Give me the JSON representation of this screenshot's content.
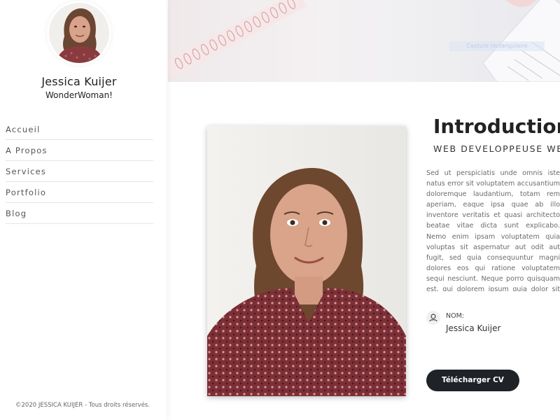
{
  "profile": {
    "name": "Jessica Kuijer",
    "tagline": "WonderWoman!"
  },
  "nav": {
    "items": [
      {
        "label": "Accueil"
      },
      {
        "label": "A Propos"
      },
      {
        "label": "Services"
      },
      {
        "label": "Portfolio"
      },
      {
        "label": "Blog"
      }
    ]
  },
  "footer": {
    "copyright": "©2020 JESSICA KUIJER - Tous droits réservés."
  },
  "hero": {
    "overlay_text": "Capture rectangulaire"
  },
  "intro": {
    "title": "Introduction",
    "subtitle": "WEB DEVELOPPEUSE WEB",
    "description": "Sed ut perspiciatis unde omnis iste natus error sit voluptatem accusantium doloremque laudantium, totam rem aperiam, eaque ipsa quae ab illo inventore veritatis et quasi architecto beatae vitae dicta sunt explicabo. Nemo enim ipsam voluptatem quia voluptas sit aspernatur aut odit aut fugit, sed quia consequuntur magni dolores eos qui ratione voluptatem sequi nesciunt. Neque porro quisquam est, qui dolorem ipsum quia dolor sit amet, consectetur, adipisci velit, sed quia non numquam eius modi tempora incidunt ut labore et dolore magnam aliquam quaerat voluptatem. Ut enim ad minima veniam, quis nostrum exercitationem ullam corporis suscipit laboriosam, nisi ut aliquid ex ea commodi consequatur? Quis autem vel eum iure reprehenderit qui in ea voluptate velit esse quam nihil molestiae consequatur, vel illum qui dolorem eum fugiat quo voluptas nulla pariatur?",
    "info_label": "NOM:",
    "info_value": "Jessica Kuijer",
    "cv_button": "Télécharger CV"
  },
  "colors": {
    "button_bg": "#1f2328",
    "divider": "#e6e6e6"
  },
  "icons": {
    "user": "user-icon"
  }
}
